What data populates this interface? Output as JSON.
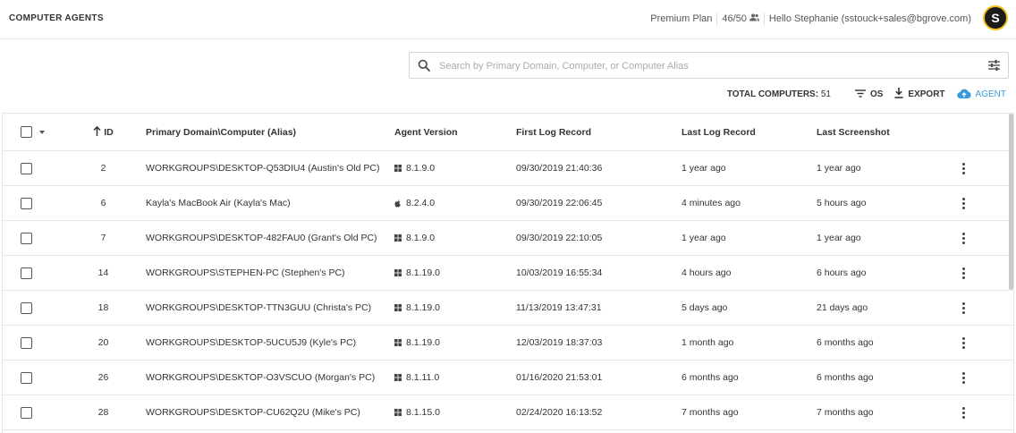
{
  "app": {
    "title": "COMPUTER AGENTS"
  },
  "header": {
    "plan": "Premium Plan",
    "seats": "46/50",
    "greeting": "Hello Stephanie (sstouck+sales@bgrove.com)",
    "avatar_initial": "S"
  },
  "search": {
    "placeholder": "Search by Primary Domain, Computer, or Computer Alias",
    "value": ""
  },
  "toolbar": {
    "total_label": "TOTAL COMPUTERS:",
    "total_value": "51",
    "os_label": "OS",
    "export_label": "EXPORT",
    "agent_label": "AGENT"
  },
  "colors": {
    "accent": "#3a9ad9",
    "avatar_bg": "#1b1b1b",
    "avatar_ring": "#f2c21b"
  },
  "table": {
    "columns": {
      "id": "ID",
      "domain": "Primary Domain\\Computer (Alias)",
      "version": "Agent Version",
      "first": "First Log Record",
      "last": "Last Log Record",
      "shot": "Last Screenshot"
    },
    "rows": [
      {
        "id": "2",
        "domain": "WORKGROUPS\\DESKTOP-Q53DIU4 (Austin's Old PC)",
        "os": "windows",
        "version": "8.1.9.0",
        "first": "09/30/2019 21:40:36",
        "last": "1 year ago",
        "shot": "1 year ago"
      },
      {
        "id": "6",
        "domain": "Kayla's MacBook Air (Kayla's Mac)",
        "os": "apple",
        "version": "8.2.4.0",
        "first": "09/30/2019 22:06:45",
        "last": "4 minutes ago",
        "shot": "5 hours ago"
      },
      {
        "id": "7",
        "domain": "WORKGROUPS\\DESKTOP-482FAU0 (Grant's Old PC)",
        "os": "windows",
        "version": "8.1.9.0",
        "first": "09/30/2019 22:10:05",
        "last": "1 year ago",
        "shot": "1 year ago"
      },
      {
        "id": "14",
        "domain": "WORKGROUPS\\STEPHEN-PC (Stephen's PC)",
        "os": "windows",
        "version": "8.1.19.0",
        "first": "10/03/2019 16:55:34",
        "last": "4 hours ago",
        "shot": "6 hours ago"
      },
      {
        "id": "18",
        "domain": "WORKGROUPS\\DESKTOP-TTN3GUU (Christa's PC)",
        "os": "windows",
        "version": "8.1.19.0",
        "first": "11/13/2019 13:47:31",
        "last": "5 days ago",
        "shot": "21 days ago"
      },
      {
        "id": "20",
        "domain": "WORKGROUPS\\DESKTOP-5UCU5J9 (Kyle's PC)",
        "os": "windows",
        "version": "8.1.19.0",
        "first": "12/03/2019 18:37:03",
        "last": "1 month ago",
        "shot": "6 months ago"
      },
      {
        "id": "26",
        "domain": "WORKGROUPS\\DESKTOP-O3VSCUO (Morgan's PC)",
        "os": "windows",
        "version": "8.1.11.0",
        "first": "01/16/2020 21:53:01",
        "last": "6 months ago",
        "shot": "6 months ago"
      },
      {
        "id": "28",
        "domain": "WORKGROUPS\\DESKTOP-CU62Q2U (Mike's PC)",
        "os": "windows",
        "version": "8.1.15.0",
        "first": "02/24/2020 16:13:52",
        "last": "7 months ago",
        "shot": "7 months ago"
      }
    ]
  }
}
